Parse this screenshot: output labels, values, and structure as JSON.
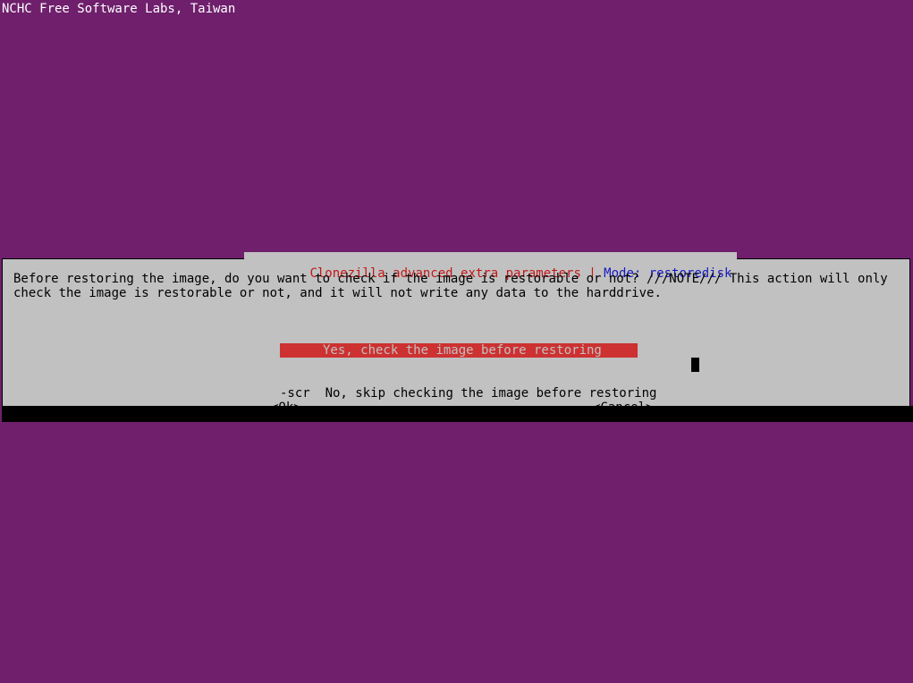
{
  "header": {
    "org": "NCHC Free Software Labs, Taiwan"
  },
  "dialog": {
    "title_left": "Clonezilla advanced extra parameters",
    "title_sep": " | ",
    "title_right": "Mode: restoredisk",
    "message": "Before restoring the image, do you want to check if the image is restorable or not? ///NOTE/// This action will only check the image is restorable or not, and it will not write any data to the harddrive.",
    "options": [
      {
        "flag": "",
        "label": "Yes, check the image before restoring",
        "selected": true
      },
      {
        "flag": "-scr",
        "label": "No, skip checking the image before restoring",
        "selected": false
      }
    ],
    "buttons": {
      "ok": "<Ok>",
      "cancel": "<Cancel>"
    }
  }
}
